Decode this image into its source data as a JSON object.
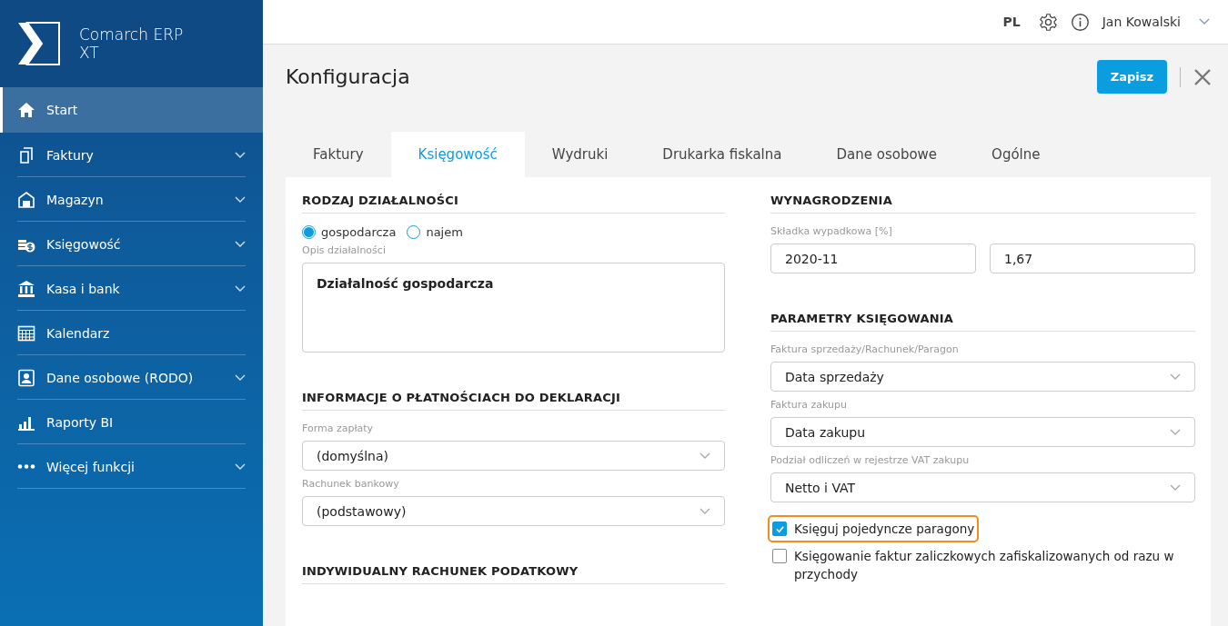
{
  "app": {
    "name": "Comarch ERP XT"
  },
  "sidebar": {
    "items": [
      {
        "label": "Start",
        "expandable": false,
        "selected": true
      },
      {
        "label": "Faktury",
        "expandable": true,
        "selected": false
      },
      {
        "label": "Magazyn",
        "expandable": true,
        "selected": false
      },
      {
        "label": "Księgowość",
        "expandable": true,
        "selected": false
      },
      {
        "label": "Kasa i bank",
        "expandable": true,
        "selected": false
      },
      {
        "label": "Kalendarz",
        "expandable": false,
        "selected": false
      },
      {
        "label": "Dane osobowe (RODO)",
        "expandable": true,
        "selected": false
      },
      {
        "label": "Raporty BI",
        "expandable": false,
        "selected": false
      },
      {
        "label": "Więcej funkcji",
        "expandable": true,
        "selected": false
      }
    ]
  },
  "header": {
    "language": "PL",
    "user": "Jan Kowalski"
  },
  "page": {
    "title": "Konfiguracja",
    "save_button": "Zapisz"
  },
  "tabs": [
    {
      "label": "Faktury",
      "selected": false
    },
    {
      "label": "Księgowość",
      "selected": true
    },
    {
      "label": "Wydruki",
      "selected": false
    },
    {
      "label": "Drukarka fiskalna",
      "selected": false
    },
    {
      "label": "Dane osobowe",
      "selected": false
    },
    {
      "label": "Ogólne",
      "selected": false
    }
  ],
  "columns": [
    [
      {
        "heading": "RODZAJ DZIAŁALNOŚCI",
        "fields": [
          {
            "kind": "radio",
            "options": [
              {
                "label": "gospodarcza",
                "selected": true
              },
              {
                "label": "najem",
                "selected": false
              }
            ]
          },
          {
            "kind": "textarea",
            "label": "Opis działalności",
            "value": "Działalność gospodarcza"
          }
        ]
      },
      {
        "heading": "INFORMACJE O PŁATNOŚCIACH DO DEKLARACJI",
        "fields": [
          {
            "kind": "select",
            "label": "Forma zapłaty",
            "value": "(domyślna)"
          },
          {
            "kind": "select",
            "label": "Rachunek bankowy",
            "value": "(podstawowy)"
          }
        ]
      },
      {
        "heading": "INDYWIDUALNY RACHUNEK PODATKOWY"
      }
    ],
    [
      {
        "heading": "WYNAGRODZENIA",
        "fields": [
          {
            "kind": "pair",
            "label": "Składka wypadkowa [%]",
            "values": [
              "2020-11",
              "1,67"
            ]
          }
        ]
      },
      {
        "heading": "PARAMETRY KSIĘGOWANIA",
        "fields": [
          {
            "kind": "select",
            "label": "Faktura sprzedaży/Rachunek/Paragon",
            "value": "Data sprzedaży"
          },
          {
            "kind": "select",
            "label": "Faktura zakupu",
            "value": "Data zakupu"
          },
          {
            "kind": "select",
            "label": "Podział odliczeń w rejestrze VAT zakupu",
            "value": "Netto i VAT"
          },
          {
            "kind": "checkbox",
            "label": "Księguj pojedyncze paragony",
            "checked": true,
            "highlighted": true
          },
          {
            "kind": "checkbox",
            "label": "Księgowanie faktur zaliczkowych zafiskalizowanych od razu w przychody",
            "checked": false,
            "highlighted": false
          }
        ]
      }
    ]
  ]
}
